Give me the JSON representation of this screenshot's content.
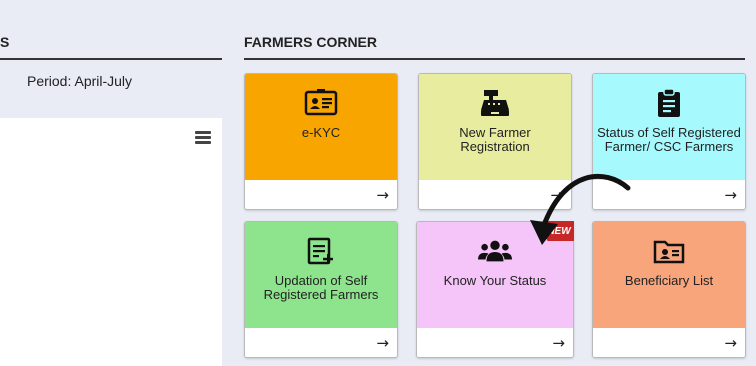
{
  "left": {
    "title_fragment": "S",
    "period": "Period: April-July"
  },
  "farmers_corner": {
    "title": "FARMERS CORNER",
    "cards": [
      {
        "label": "e-KYC",
        "color": "#f9a500",
        "icon": "id-card-icon"
      },
      {
        "label": "New Farmer Registration",
        "color": "#e8ec9f",
        "icon": "cash-register-icon"
      },
      {
        "label": "Status of Self Registered Farmer/ CSC Farmers",
        "color": "#a6fafd",
        "icon": "clipboard-icon"
      },
      {
        "label": "Updation of Self Registered Farmers",
        "color": "#8ee48c",
        "icon": "edit-document-icon"
      },
      {
        "label": "Know Your Status",
        "color": "#f5c5f9",
        "icon": "users-icon",
        "badge": "NEW"
      },
      {
        "label": "Beneficiary List",
        "color": "#f9a57b",
        "icon": "folder-user-icon"
      }
    ],
    "arrow_glyph": "→"
  }
}
